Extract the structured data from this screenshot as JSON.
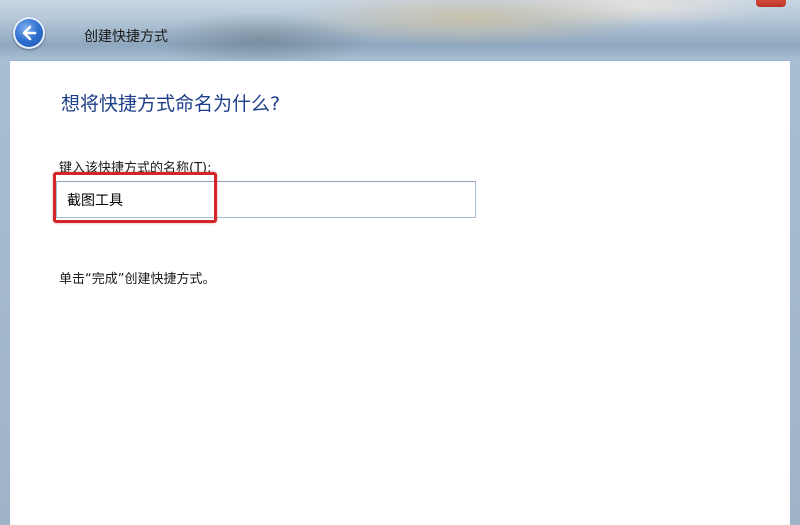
{
  "window": {
    "title": "创建快捷方式",
    "back_icon": "back-arrow-icon"
  },
  "page": {
    "heading": "想将快捷方式命名为什么?",
    "field_label": "键入该快捷方式的名称(T):",
    "name_value": "截图工具",
    "hint": "单击“完成”创建快捷方式。"
  },
  "colors": {
    "heading": "#1e3f8a",
    "highlight": "#d3262a",
    "back_button": "#2f6fd0"
  }
}
